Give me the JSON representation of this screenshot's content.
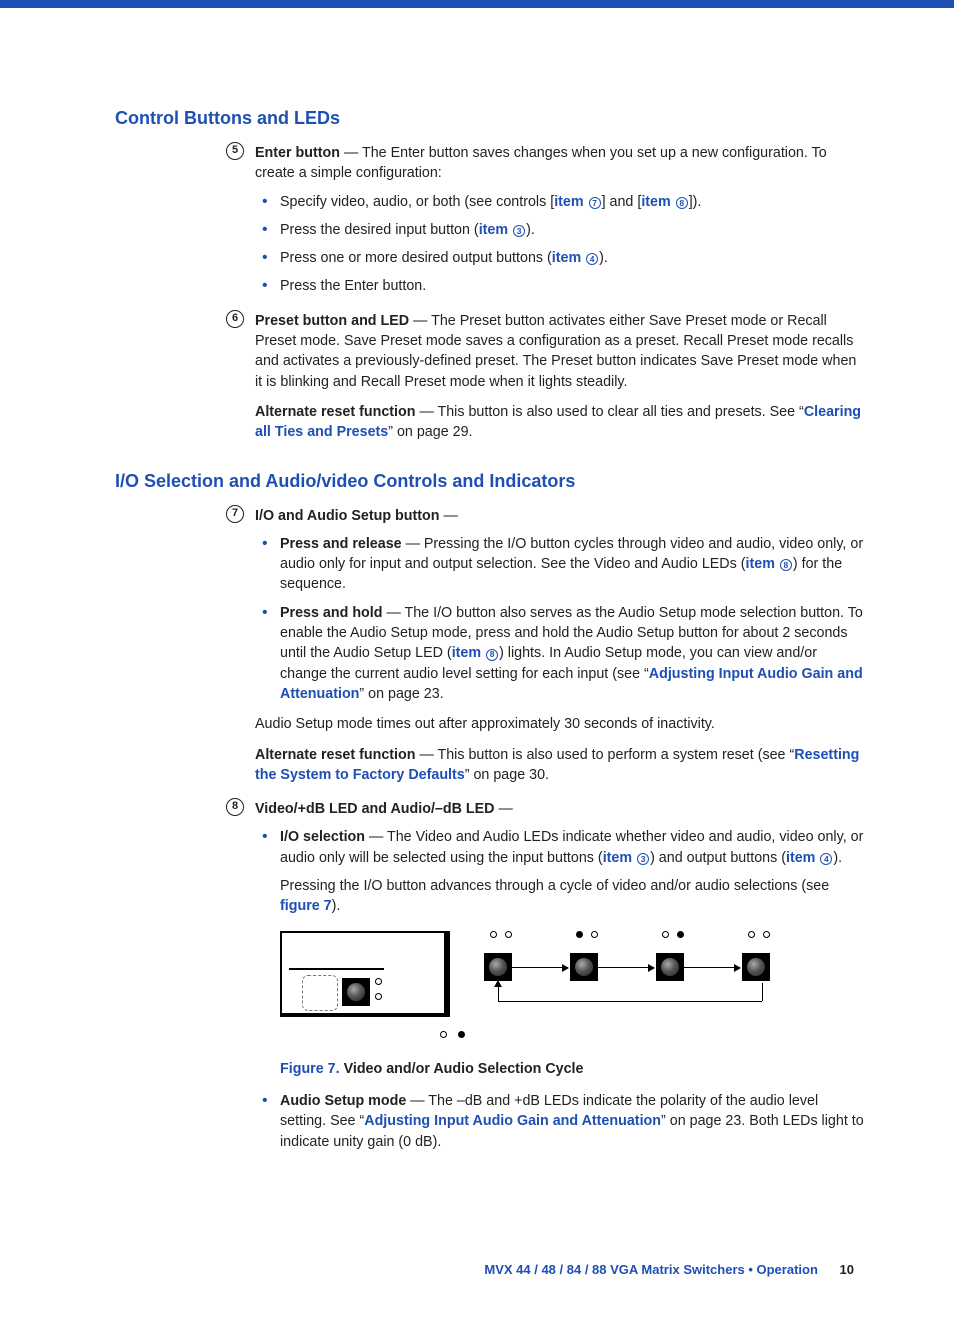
{
  "sections": {
    "s1": {
      "title": "Control Buttons and LEDs"
    },
    "s2": {
      "title": "I/O Selection and Audio/video Controls and Indicators"
    }
  },
  "items": {
    "i5": {
      "num": "5",
      "label": "Enter button",
      "dash": " — ",
      "text": "The Enter button saves changes when you set up a new configuration. To create a simple configuration:",
      "b1a": "Specify video, audio, or both (see controls [",
      "b1_link1": "item ",
      "b1_ref1": "7",
      "b1b": "] and [",
      "b1_link2": "item ",
      "b1_ref2": "8",
      "b1c": "]).",
      "b2a": "Press the desired input button (",
      "b2_link": "item ",
      "b2_ref": "3",
      "b2b": ").",
      "b3a": "Press one or more desired output buttons (",
      "b3_link": "item ",
      "b3_ref": "4",
      "b3b": ").",
      "b4": "Press the Enter button."
    },
    "i6": {
      "num": "6",
      "label": "Preset button and LED",
      "dash": " — ",
      "text": "The Preset button activates either Save Preset mode or Recall Preset mode. Save Preset mode saves a configuration as a preset. Recall Preset mode recalls and activates a previously-defined preset. The Preset button indicates Save Preset mode when it is blinking and Recall Preset mode when it lights steadily.",
      "alt_label": "Alternate reset function",
      "alt_text": " — This button is also used to clear all ties and presets. See “",
      "alt_link": "Clearing all Ties and Presets",
      "alt_tail": "” on page 29."
    },
    "i7": {
      "num": "7",
      "label": "I/O and Audio Setup button",
      "dash": " —",
      "b1_label": "Press and release",
      "b1a": " — Pressing the I/O button cycles through video and audio, video only, or audio only for input and output selection. See the Video and Audio LEDs (",
      "b1_link": "item ",
      "b1_ref": "8",
      "b1b": ") for the sequence.",
      "b2_label": "Press and hold",
      "b2a": " — The I/O button also serves as the Audio Setup mode selection button. To enable the Audio Setup mode, press and hold the Audio Setup button for about 2 seconds until the Audio Setup LED (",
      "b2_link": "item ",
      "b2_ref": "8",
      "b2b": ") lights. In Audio Setup mode, you can view and/or change the current audio level setting for each input (see “",
      "b2_link2": "Adjusting Input Audio Gain and Attenuation",
      "b2c": "” on page 23.",
      "p1": "Audio Setup mode times out after approximately 30 seconds of inactivity.",
      "alt_label": "Alternate reset function",
      "alt_text": " — This button is also used to perform a system reset (see “",
      "alt_link": "Resetting the System to Factory Defaults",
      "alt_tail": "” on page 30."
    },
    "i8": {
      "num": "8",
      "label": "Video/+dB LED and Audio/–dB LED",
      "dash": " —",
      "b1_label": "I/O selection",
      "b1a": " — The Video and Audio LEDs indicate whether video and audio, video only, or audio only will be selected using the input buttons (",
      "b1_link1": "item ",
      "b1_ref1": "3",
      "b1b": ") and output buttons (",
      "b1_link2": "item ",
      "b1_ref2": "4",
      "b1c": ").",
      "b1p2a": "Pressing the I/O button advances through a cycle of video and/or audio selections (see ",
      "b1p2_link": "figure 7",
      "b1p2b": ").",
      "fig_label": "Figure 7.",
      "fig_title": "   Video and/or Audio Selection Cycle",
      "b2_label": "Audio Setup mode",
      "b2a": " — The –dB and +dB LEDs indicate the polarity of the audio level setting. See “",
      "b2_link": "Adjusting Input Audio Gain and Attenuation",
      "b2b": "” on page 23. Both LEDs light to indicate unity gain (0 dB)."
    }
  },
  "footer": {
    "text": "MVX 44 / 48 / 84 / 88 VGA Matrix Switchers • Operation",
    "page": "10"
  }
}
